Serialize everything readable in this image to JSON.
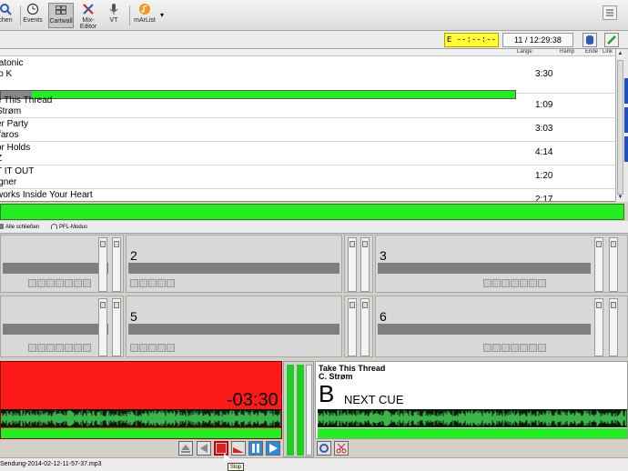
{
  "toolbar": {
    "buttons": [
      {
        "label": "chen",
        "icon": "search-icon"
      },
      {
        "label": "Events",
        "icon": "clock-icon"
      },
      {
        "label": "Cartwall",
        "icon": "grid-icon"
      },
      {
        "label": "Mix-Editor",
        "icon": "mix-icon"
      },
      {
        "label": "VT",
        "icon": "microphone-icon"
      },
      {
        "label": "mArList",
        "icon": "music-icon"
      }
    ]
  },
  "status": {
    "timer": "E  --:--:--",
    "clock": "11 / 12:29:38"
  },
  "playlist": {
    "columns": [
      "Länge",
      "Ramp",
      "Ende",
      "Link"
    ],
    "current": {
      "title": "tatonic",
      "artist": "io K",
      "length": "3:30",
      "progress": 0.06
    },
    "rows": [
      {
        "title": "e This Thread",
        "artist": "Strøm",
        "length": "1:09"
      },
      {
        "title": "er Party",
        "artist": "ifaros",
        "length": "3:03"
      },
      {
        "title": "or Holds",
        "artist": "Z",
        "length": "4:14"
      },
      {
        "title": "T IT OUT",
        "artist": "igner",
        "length": "1:20"
      },
      {
        "title": "works Inside Your Heart",
        "artist": "",
        "length": "2:17"
      }
    ]
  },
  "cartwall": {
    "toolbar": {
      "close_all": "Alle schließen",
      "pfl": "PFL-Modus"
    },
    "carts": [
      "",
      "2",
      "3",
      "",
      "5",
      "6"
    ]
  },
  "player_a": {
    "remaining": "-03:30",
    "color": "#ff1a1a"
  },
  "player_b": {
    "title": "Take This Thread",
    "artist": "C. Strøm",
    "letter": "B",
    "cue": "NEXT CUE"
  },
  "statusline": {
    "file": "Sendung-2014-02-12-11-57-37.mp3",
    "tooltip": "Stop"
  },
  "colors": {
    "green": "#22ee22",
    "red": "#ff1a1a",
    "yellow": "#ffff33",
    "blue": "#2050c0"
  }
}
